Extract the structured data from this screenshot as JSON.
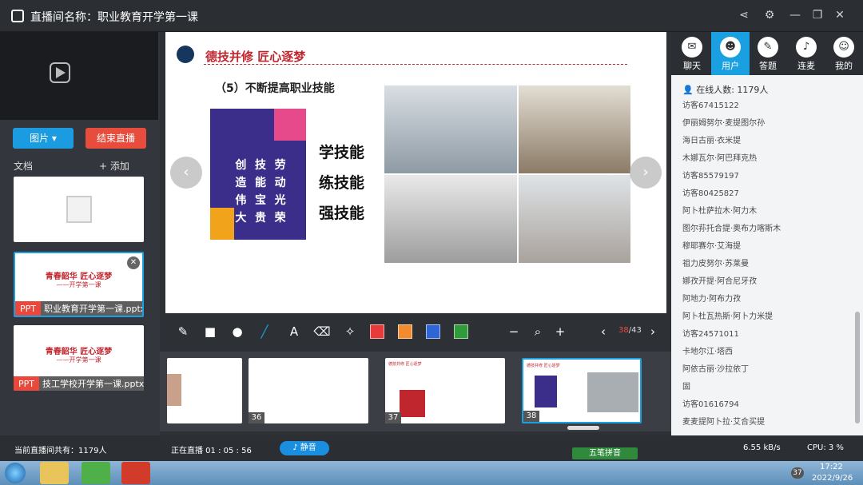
{
  "window": {
    "title": "直播间名称：职业教育开学第一课"
  },
  "left": {
    "pic_btn": "图片 ▾",
    "end_btn": "结束直播",
    "doc_label": "文档",
    "add_label": "+ 添加",
    "docs": [
      {
        "badge": "PPT",
        "name": "职业教育开学第一课.pptx",
        "title": "青春韶华 匠心逐梦",
        "sub": "——开学第一课"
      },
      {
        "badge": "PPT",
        "name": "技工学校开学第一课.pptx",
        "title": "青春韶华 匠心逐梦",
        "sub": "——开学第一课"
      }
    ]
  },
  "slide": {
    "header": "德技并修 匠心逐梦",
    "subtitle": "（5）不断提高职业技能",
    "poster_chars": [
      "创",
      "技",
      "劳",
      "造",
      "能",
      "动",
      "伟",
      "宝",
      "光",
      "大",
      "贵",
      "荣"
    ],
    "skills": [
      "学技能",
      "练技能",
      "强技能"
    ]
  },
  "toolbar": {
    "page_current": "38",
    "page_total": "/43"
  },
  "thumbs": [
    {
      "num": "",
      "text": ""
    },
    {
      "num": "36",
      "text": ""
    },
    {
      "num": "37",
      "text": "德技并修 匠心逐梦"
    },
    {
      "num": "38",
      "text": "德技并修 匠心逐梦"
    }
  ],
  "right": {
    "tabs": [
      "聊天",
      "用户",
      "答题",
      "连麦",
      "我的"
    ],
    "online": "在线人数: 1179人",
    "users": [
      "访客67415122",
      "伊丽姆努尔·麦提图尔孙",
      "海日古丽·衣米提",
      "木娜瓦尔·阿巴拜克热",
      "访客85579197",
      "访客80425827",
      "阿卜杜萨拉木·阿力木",
      "图尔荪托合提·奥布力喀斯木",
      "穆耶赛尔·艾海提",
      "祖力皮努尔·苏莱曼",
      "娜孜开提·阿合尼牙孜",
      "阿地力·阿布力孜",
      "阿卜杜瓦热斯·阿卜力米提",
      "访客24571011",
      "卡地尔江·塔西",
      "阿依古丽·沙拉依丁",
      "固",
      "访客01616794",
      "麦麦提阿卜拉·艾合买提"
    ]
  },
  "status": {
    "total": "当前直播间共有：1179人",
    "live": "正在直播 01 : 05 : 56",
    "mute": "静音",
    "ime": "五笔拼音",
    "speed": "6.55 kB/s",
    "cpu": "CPU:  3 %"
  },
  "taskbar": {
    "time": "17:22",
    "date": "2022/9/26",
    "badge": "37"
  },
  "colors": {
    "accent": "#1aa0e0",
    "red": "#e84c3d",
    "slide_red": "#c0262e"
  }
}
